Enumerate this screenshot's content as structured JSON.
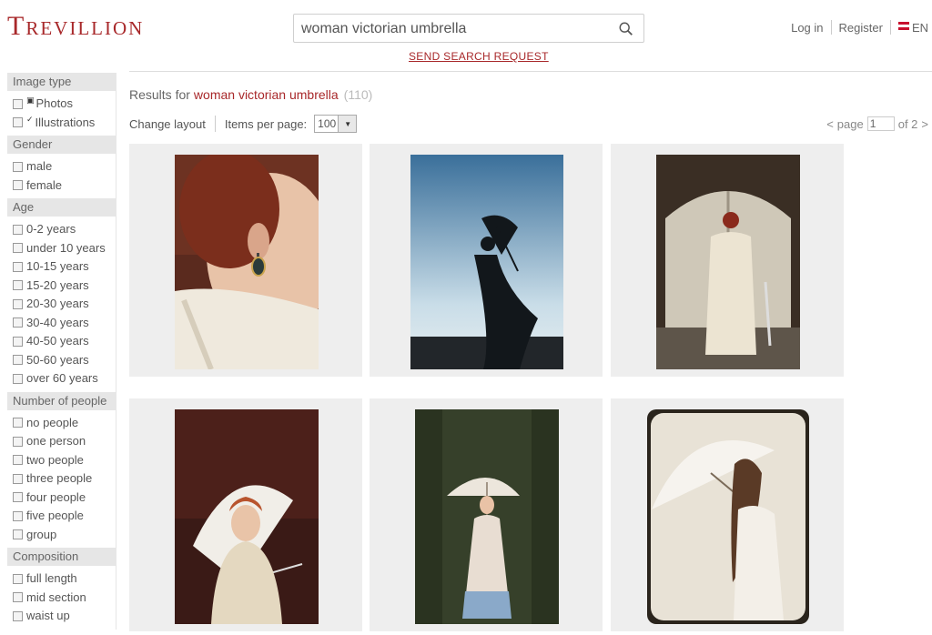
{
  "brand": {
    "logo_text": "Trevillion"
  },
  "search": {
    "value": "woman victorian umbrella",
    "send_request": "SEND SEARCH REQUEST"
  },
  "top_nav": {
    "login": "Log in",
    "register": "Register",
    "language": "EN"
  },
  "sidebar": {
    "image_type": {
      "title": "Image type",
      "items": [
        "Photos",
        "Illustrations"
      ]
    },
    "gender": {
      "title": "Gender",
      "items": [
        "male",
        "female"
      ]
    },
    "age": {
      "title": "Age",
      "items": [
        "0-2 years",
        "under 10 years",
        "10-15 years",
        "15-20 years",
        "20-30 years",
        "30-40 years",
        "40-50 years",
        "50-60 years",
        "over 60 years"
      ]
    },
    "people": {
      "title": "Number of people",
      "items": [
        "no people",
        "one person",
        "two people",
        "three people",
        "four people",
        "five people",
        "group"
      ]
    },
    "composition": {
      "title": "Composition",
      "items": [
        "full length",
        "mid section",
        "waist up"
      ]
    }
  },
  "results": {
    "label": "Results for",
    "query": "woman victorian umbrella",
    "count": "(110)"
  },
  "toolbar": {
    "change_layout": "Change layout",
    "items_per_page_label": "Items per page:",
    "items_per_page_value": "100"
  },
  "pager": {
    "prev": "<",
    "page_label": "page",
    "current": "1",
    "of_label": "of 2",
    "next": ">"
  },
  "images": [
    {
      "alt": "woman earring close-up"
    },
    {
      "alt": "silhouette with umbrella"
    },
    {
      "alt": "woman at wooden door"
    },
    {
      "alt": "redhead with parasol"
    },
    {
      "alt": "woman with parasol in woods"
    },
    {
      "alt": "vintage woman with parasol"
    }
  ]
}
